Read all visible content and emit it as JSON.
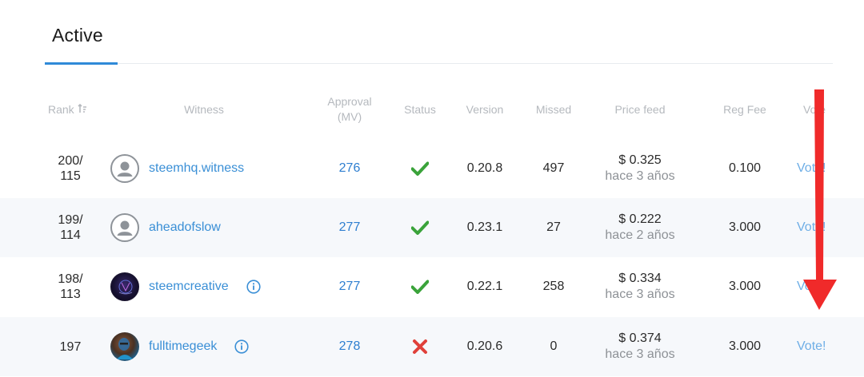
{
  "tabs": [
    {
      "label": "Active"
    }
  ],
  "columns": {
    "rank": "Rank",
    "witness": "Witness",
    "approval": "Approval",
    "approval_unit": "(MV)",
    "status": "Status",
    "version": "Version",
    "missed": "Missed",
    "price_feed": "Price feed",
    "reg_fee": "Reg Fee",
    "vote": "Vote"
  },
  "rows": [
    {
      "rank_top": "200/",
      "rank_bottom": "115",
      "rank_single": "",
      "avatar": "default-user-icon",
      "witness": "steemhq.witness",
      "info": false,
      "approval": "276",
      "status": "active",
      "version": "0.20.8",
      "missed": "497",
      "price": "$ 0.325",
      "price_time": "hace 3 años",
      "fee": "0.100",
      "vote": "Vote!"
    },
    {
      "rank_top": "199/",
      "rank_bottom": "114",
      "rank_single": "",
      "avatar": "default-user-icon",
      "witness": "aheadofslow",
      "info": false,
      "approval": "277",
      "status": "active",
      "version": "0.23.1",
      "missed": "27",
      "price": "$ 0.222",
      "price_time": "hace 2 años",
      "fee": "3.000",
      "vote": "Vote!"
    },
    {
      "rank_top": "198/",
      "rank_bottom": "113",
      "rank_single": "",
      "avatar": "steemcreative-avatar",
      "witness": "steemcreative",
      "info": true,
      "approval": "277",
      "status": "active",
      "version": "0.22.1",
      "missed": "258",
      "price": "$ 0.334",
      "price_time": "hace 3 años",
      "fee": "3.000",
      "vote": "Vote!"
    },
    {
      "rank_top": "",
      "rank_bottom": "",
      "rank_single": "197",
      "avatar": "fulltimegeek-avatar",
      "witness": "fulltimegeek",
      "info": true,
      "approval": "278",
      "status": "disabled",
      "version": "0.20.6",
      "missed": "0",
      "price": "$ 0.374",
      "price_time": "hace 3 años",
      "fee": "3.000",
      "vote": "Vote!"
    }
  ],
  "colors": {
    "accent": "#2f8ad8",
    "link": "#3a8fd6",
    "check": "#3aa33a",
    "cross": "#e0403a",
    "arrow": "#f02a2a",
    "row_alt_bg": "#f6f8fb"
  }
}
